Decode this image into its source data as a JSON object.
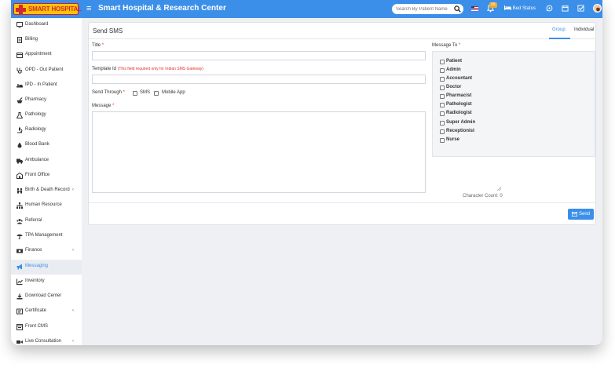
{
  "header": {
    "logo_text": "SMART HOSPITAL",
    "app_title": "Smart Hospital & Research Center",
    "search_placeholder": "Search By Patient Name",
    "notification_count": "99",
    "bed_status_label": "Bed Status"
  },
  "sidebar": {
    "items": [
      {
        "label": "Dashboard",
        "icon": "monitor-icon"
      },
      {
        "label": "Billing",
        "icon": "file-icon"
      },
      {
        "label": "Appointment",
        "icon": "calendar-icon"
      },
      {
        "label": "OPD - Out Patient",
        "icon": "stethoscope-icon"
      },
      {
        "label": "IPD - In Patient",
        "icon": "procedures-icon"
      },
      {
        "label": "Pharmacy",
        "icon": "mortar-pestle-icon"
      },
      {
        "label": "Pathology",
        "icon": "flask-icon"
      },
      {
        "label": "Radiology",
        "icon": "microscope-icon"
      },
      {
        "label": "Blood Bank",
        "icon": "blood-drop-icon"
      },
      {
        "label": "Ambulance",
        "icon": "ambulance-icon"
      },
      {
        "label": "Front Office",
        "icon": "building-icon"
      },
      {
        "label": "Birth & Death Record",
        "icon": "family-icon",
        "has_submenu": true
      },
      {
        "label": "Human Resource",
        "icon": "sitemap-icon"
      },
      {
        "label": "Referral",
        "icon": "users-icon"
      },
      {
        "label": "TPA Management",
        "icon": "umbrella-icon"
      },
      {
        "label": "Finance",
        "icon": "money-icon",
        "has_submenu": true
      },
      {
        "label": "Messaging",
        "icon": "bullhorn-icon",
        "active": true
      },
      {
        "label": "Inventory",
        "icon": "chart-icon"
      },
      {
        "label": "Download Center",
        "icon": "download-icon"
      },
      {
        "label": "Certificate",
        "icon": "certificate-icon",
        "has_submenu": true
      },
      {
        "label": "Front CMS",
        "icon": "cms-icon"
      },
      {
        "label": "Live Consultation",
        "icon": "video-icon",
        "has_submenu": true
      }
    ]
  },
  "card": {
    "title": "Send SMS",
    "tabs": [
      {
        "label": "Group",
        "active": true
      },
      {
        "label": "Individual",
        "active": false
      }
    ]
  },
  "form": {
    "title_label": "Title",
    "template_id_label": "Template Id",
    "template_id_note": "(This field required only for Indian SMS Gateway)",
    "send_through_label": "Send Through",
    "send_through_options": [
      "SMS",
      "Mobile App"
    ],
    "message_label": "Message",
    "character_count": "Character Count: 0",
    "message_to_label": "Message To",
    "roles": [
      "Patient",
      "Admin",
      "Accountant",
      "Doctor",
      "Pharmacist",
      "Pathologist",
      "Radiologist",
      "Super Admin",
      "Receptionist",
      "Nurse"
    ],
    "send_button": "Send",
    "required_marker": "*"
  },
  "colors": {
    "primary": "#3c8fe8",
    "logo_bg": "#fec107",
    "required": "#e0312f"
  }
}
